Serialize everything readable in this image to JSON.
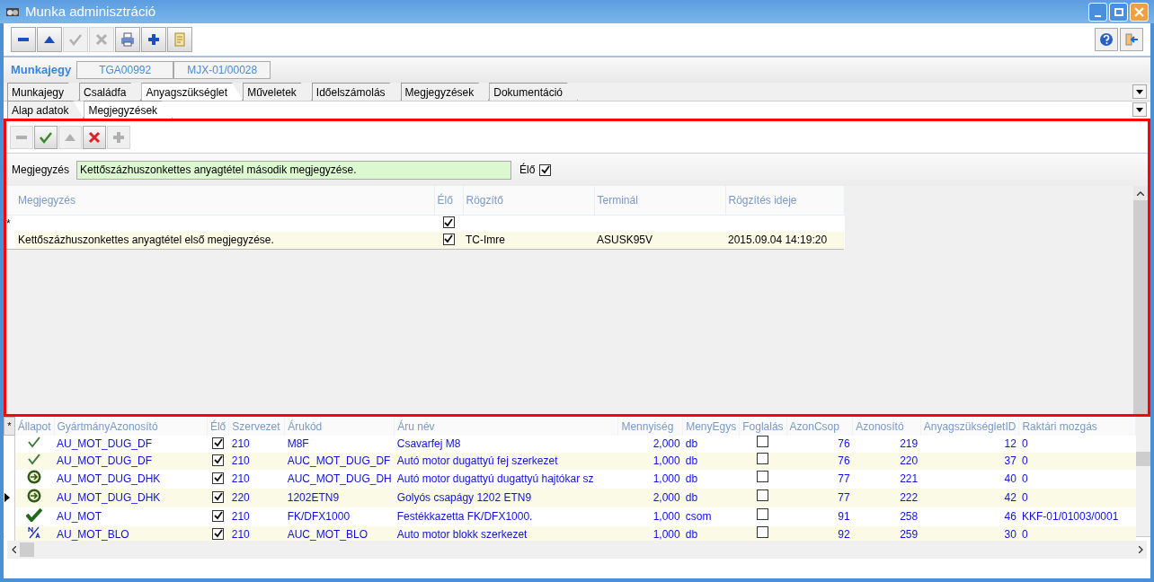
{
  "window": {
    "title": "Munka adminisztráció"
  },
  "toolbar": [
    {
      "disabled": false
    },
    {
      "disabled": false
    },
    {
      "disabled": true
    },
    {
      "disabled": true
    },
    {
      "disabled": false
    },
    {
      "disabled": false
    },
    {
      "disabled": false
    }
  ],
  "header": {
    "label": "Munkajegy",
    "fields": [
      "TGA00992",
      "MJX-01/00028"
    ]
  },
  "main_tabs": [
    {
      "label": "Munkajegy",
      "selected": false
    },
    {
      "label": "Családfa",
      "selected": false
    },
    {
      "label": "Anyagszükséglet",
      "selected": true
    },
    {
      "label": "Műveletek",
      "selected": false
    },
    {
      "label": "Időelszámolás",
      "selected": false
    },
    {
      "label": "Megjegyzések",
      "selected": false
    },
    {
      "label": "Dokumentáció",
      "selected": false
    }
  ],
  "sub_tabs": [
    {
      "label": "Alap adatok",
      "selected": false
    },
    {
      "label": "Megjegyzések",
      "selected": true
    }
  ],
  "notes": {
    "toolbar": [
      {
        "disabled": true
      },
      {
        "disabled": false
      },
      {
        "disabled": true
      },
      {
        "disabled": false
      },
      {
        "disabled": true
      }
    ],
    "field": {
      "label": "Megjegyzés",
      "value": "Kettőszázhuszonkettes anyagtétel második megjegyzése."
    },
    "live": {
      "label": "Élő",
      "checked": true
    },
    "columns": [
      "Megjegyzés",
      "Élő",
      "Rögzítő",
      "Terminál",
      "Rögzítés ideje"
    ],
    "new_row": {
      "marker": "*",
      "live": true
    },
    "rows": [
      {
        "note": "Kettőszázhuszonkettes anyagtétel első megjegyzése.",
        "live": true,
        "recorder": "TC-Imre",
        "terminal": "ASUSK95V",
        "time": "2015.09.04 14:19:20"
      }
    ]
  },
  "parts": {
    "corner": "*",
    "columns": [
      "Állapot",
      "GyártmányAzonosító",
      "Élő",
      "Szervezet",
      "Árukód",
      "Áru név",
      "Mennyiség",
      "MenyEgys",
      "Foglalás",
      "AzonCsop",
      "Azonosító",
      "AnyagszükségletID",
      "Raktári mozgás"
    ],
    "rows": [
      {
        "kind": "check",
        "selected": false,
        "product": "AU_MOT_DUG_DF",
        "live": true,
        "org": "210",
        "code": "M8F",
        "name": "Csavarfej M8",
        "qty": "2,000",
        "unit": "db",
        "reserved": false,
        "group": "76",
        "id": "219",
        "req_id": "12",
        "movement": "0"
      },
      {
        "kind": "check",
        "selected": false,
        "product": "AU_MOT_DUG_DF",
        "live": true,
        "org": "210",
        "code": "AUC_MOT_DUG_DF",
        "name": "Autó motor dugattyú fej szerkezet",
        "qty": "1,000",
        "unit": "db",
        "reserved": false,
        "group": "76",
        "id": "220",
        "req_id": "37",
        "movement": "0"
      },
      {
        "kind": "arrow",
        "selected": false,
        "product": "AU_MOT_DUG_DHK",
        "live": true,
        "org": "210",
        "code": "AUC_MOT_DUG_DH",
        "name": "Autó motor dugattyú dugattyú hajtókar sz",
        "qty": "1,000",
        "unit": "db",
        "reserved": false,
        "group": "77",
        "id": "221",
        "req_id": "40",
        "movement": "0"
      },
      {
        "kind": "arrow",
        "selected": true,
        "product": "AU_MOT_DUG_DHK",
        "live": true,
        "org": "220",
        "code": "1202ETN9",
        "name": "Golyós csapágy 1202 ETN9",
        "qty": "2,000",
        "unit": "db",
        "reserved": false,
        "group": "77",
        "id": "222",
        "req_id": "42",
        "movement": "0"
      },
      {
        "kind": "bold",
        "selected": false,
        "product": "AU_MOT",
        "live": true,
        "org": "210",
        "code": "FK/DFX1000",
        "name": "Festékkazetta FK/DFX1000.",
        "qty": "1,000",
        "unit": "csom",
        "reserved": false,
        "group": "91",
        "id": "258",
        "req_id": "46",
        "movement": "KKF-01/01003/0001"
      },
      {
        "kind": "na",
        "selected": false,
        "product": "AU_MOT_BLO",
        "live": true,
        "org": "210",
        "code": "AUC_MOT_BLO",
        "name": "Auto motor blokk szerkezet",
        "qty": "1,000",
        "unit": "db",
        "reserved": false,
        "group": "92",
        "id": "259",
        "req_id": "30",
        "movement": "0"
      }
    ]
  }
}
